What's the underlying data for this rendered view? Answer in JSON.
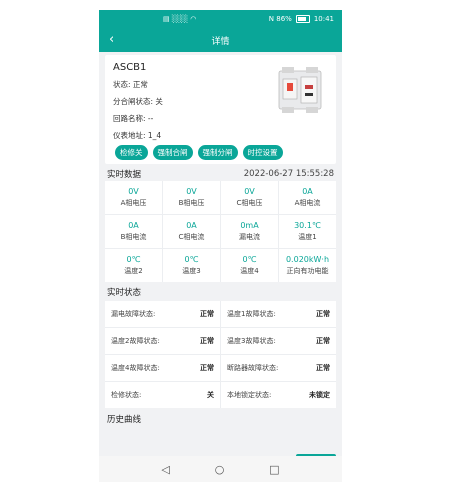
{
  "statusbar": {
    "left": "▤ ░░░ ◠",
    "battery": "N 86%",
    "time": "10:41"
  },
  "header": {
    "title": "详情",
    "back": "‹"
  },
  "device": {
    "name": "ASCB1",
    "fields": [
      {
        "label": "状态: 正常"
      },
      {
        "label": "分合闸状态: 关"
      },
      {
        "label": "回路名称: --"
      },
      {
        "label": "仪表地址: 1_4"
      }
    ],
    "buttons": [
      "检修关",
      "强制合闸",
      "强制分闸",
      "时控设置"
    ]
  },
  "realtime": {
    "title": "实时数据",
    "timestamp": "2022-06-27 15:55:28",
    "cells": [
      {
        "v": "0V",
        "l": "A相电压"
      },
      {
        "v": "0V",
        "l": "B相电压"
      },
      {
        "v": "0V",
        "l": "C相电压"
      },
      {
        "v": "0A",
        "l": "A相电流"
      },
      {
        "v": "0A",
        "l": "B相电流"
      },
      {
        "v": "0A",
        "l": "C相电流"
      },
      {
        "v": "0mA",
        "l": "漏电流"
      },
      {
        "v": "30.1℃",
        "l": "温度1"
      },
      {
        "v": "0℃",
        "l": "温度2"
      },
      {
        "v": "0℃",
        "l": "温度3"
      },
      {
        "v": "0℃",
        "l": "温度4"
      },
      {
        "v": "0.020kW·h",
        "l": "正向有功电能"
      }
    ]
  },
  "status": {
    "title": "实时状态",
    "items": [
      {
        "k": "漏电故障状态:",
        "v": "正常"
      },
      {
        "k": "温度1故障状态:",
        "v": "正常"
      },
      {
        "k": "温度2故障状态:",
        "v": "正常"
      },
      {
        "k": "温度3故障状态:",
        "v": "正常"
      },
      {
        "k": "温度4故障状态:",
        "v": "正常"
      },
      {
        "k": "断路器故障状态:",
        "v": "正常"
      },
      {
        "k": "检修状态:",
        "v": "关"
      },
      {
        "k": "本地锁定状态:",
        "v": "未锁定"
      }
    ]
  },
  "history": {
    "title": "历史曲线"
  },
  "nav": {
    "back": "◁",
    "home": "○",
    "recent": "□"
  },
  "colors": {
    "accent": "#0aa698"
  }
}
